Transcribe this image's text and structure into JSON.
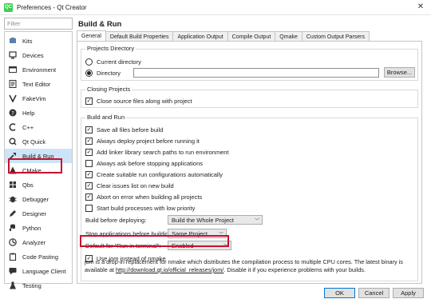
{
  "window": {
    "title": "Preferences - Qt Creator",
    "app_icon": "QC",
    "close": "✕"
  },
  "sidebar": {
    "filter_placeholder": "Filter",
    "items": [
      {
        "label": "Kits",
        "icon": "kits-icon"
      },
      {
        "label": "Devices",
        "icon": "devices-icon"
      },
      {
        "label": "Environment",
        "icon": "environment-icon"
      },
      {
        "label": "Text Editor",
        "icon": "text-editor-icon"
      },
      {
        "label": "FakeVim",
        "icon": "fakevim-icon"
      },
      {
        "label": "Help",
        "icon": "help-icon"
      },
      {
        "label": "C++",
        "icon": "cpp-icon"
      },
      {
        "label": "Qt Quick",
        "icon": "qt-quick-icon"
      },
      {
        "label": "Build & Run",
        "icon": "build-run-icon"
      },
      {
        "label": "CMake",
        "icon": "cmake-icon"
      },
      {
        "label": "Qbs",
        "icon": "qbs-icon"
      },
      {
        "label": "Debugger",
        "icon": "debugger-icon"
      },
      {
        "label": "Designer",
        "icon": "designer-icon"
      },
      {
        "label": "Python",
        "icon": "python-icon"
      },
      {
        "label": "Analyzer",
        "icon": "analyzer-icon"
      },
      {
        "label": "Code Pasting",
        "icon": "code-pasting-icon"
      },
      {
        "label": "Language Client",
        "icon": "language-client-icon"
      },
      {
        "label": "Testing",
        "icon": "testing-icon"
      }
    ],
    "selected": "Build & Run"
  },
  "panel": {
    "title": "Build & Run",
    "tabs": [
      "General",
      "Default Build Properties",
      "Application Output",
      "Compile Output",
      "Qmake",
      "Custom Output Parsers"
    ],
    "active_tab": "General"
  },
  "projects_directory": {
    "title": "Projects Directory",
    "current_directory": "Current directory",
    "directory": "Directory",
    "directory_value": "",
    "browse": "Browse...",
    "selected": "Directory"
  },
  "closing_projects": {
    "title": "Closing Projects",
    "close_source_files": {
      "label": "Close source files along with project",
      "checked": true
    }
  },
  "build_and_run": {
    "title": "Build and Run",
    "options": [
      {
        "label": "Save all files before build",
        "checked": true
      },
      {
        "label": "Always deploy project before running it",
        "checked": true
      },
      {
        "label": "Add linker library search paths to run environment",
        "checked": true
      },
      {
        "label": "Always ask before stopping applications",
        "checked": false
      },
      {
        "label": "Create suitable run configurations automatically",
        "checked": true
      },
      {
        "label": "Clear issues list on new build",
        "checked": true
      },
      {
        "label": "Abort on error when building all projects",
        "checked": true
      },
      {
        "label": "Start build processes with low priority",
        "checked": false
      }
    ],
    "build_before_deploying": {
      "label": "Build before deploying:",
      "value": "Build the Whole Project"
    },
    "stop_applications": {
      "label": "Stop applications before building:",
      "value": "Same Project"
    },
    "run_in_terminal": {
      "label": "Default for \"Run in terminal\":",
      "value": "Enabled"
    },
    "use_jom": {
      "label": "Use jom instead of nmake",
      "checked": true
    },
    "jom_text_1": "jom is a drop-in replacement for nmake which distributes the compilation process to multiple CPU cores. The latest binary is available at ",
    "jom_link": "http://download.qt.io/official_releases/jom/",
    "jom_text_2": ". Disable it if you experience problems with your builds."
  },
  "footer": {
    "ok": "OK",
    "cancel": "Cancel",
    "apply": "Apply"
  },
  "colors": {
    "highlight": "#c8102e",
    "selection": "#cce4f7",
    "accent": "#0078d7"
  }
}
